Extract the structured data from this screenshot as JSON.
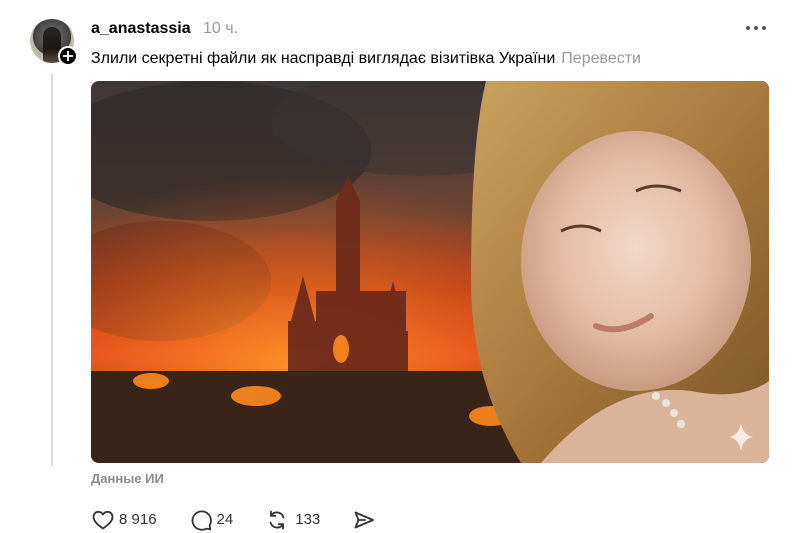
{
  "post": {
    "username": "a_anastassia",
    "time": "10 ч.",
    "text": "Злили секретні файли як насправді виглядає візитівка України",
    "translate_label": "Перевести",
    "ai_label": "Данные ИИ"
  },
  "actions": {
    "likes": "8 916",
    "comments": "24",
    "reposts": "133"
  },
  "icons": {
    "follow": "plus-icon",
    "more": "more-icon",
    "like": "heart-icon",
    "comment": "comment-icon",
    "repost": "repost-icon",
    "share": "send-icon",
    "sparkle": "sparkle-icon"
  }
}
